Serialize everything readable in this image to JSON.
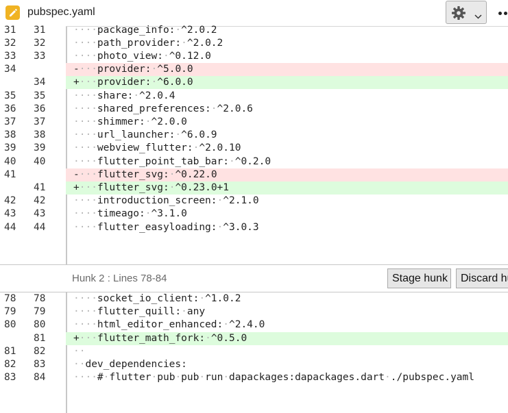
{
  "header": {
    "title": "pubspec.yaml",
    "file_icon": "edit-file-icon",
    "settings_icon": "gear-icon"
  },
  "hunk2": {
    "label": "Hunk 2 : Lines 78-84",
    "stage_label": "Stage hunk",
    "discard_label": "Discard hu"
  },
  "hunk1_rows": [
    {
      "old": "31",
      "new": "31",
      "type": "ctx",
      "indent": "    ",
      "text": "package_info: ^2.0.2"
    },
    {
      "old": "32",
      "new": "32",
      "type": "ctx",
      "indent": "    ",
      "text": "path_provider: ^2.0.2"
    },
    {
      "old": "33",
      "new": "33",
      "type": "ctx",
      "indent": "    ",
      "text": "photo_view: ^0.12.0"
    },
    {
      "old": "34",
      "new": "",
      "type": "del",
      "indent": "    ",
      "text": "provider: ^5.0.0"
    },
    {
      "old": "",
      "new": "34",
      "type": "add",
      "indent": "    ",
      "text": "provider: ^6.0.0"
    },
    {
      "old": "35",
      "new": "35",
      "type": "ctx",
      "indent": "    ",
      "text": "share: ^2.0.4"
    },
    {
      "old": "36",
      "new": "36",
      "type": "ctx",
      "indent": "    ",
      "text": "shared_preferences: ^2.0.6"
    },
    {
      "old": "37",
      "new": "37",
      "type": "ctx",
      "indent": "    ",
      "text": "shimmer: ^2.0.0"
    },
    {
      "old": "38",
      "new": "38",
      "type": "ctx",
      "indent": "    ",
      "text": "url_launcher: ^6.0.9"
    },
    {
      "old": "39",
      "new": "39",
      "type": "ctx",
      "indent": "    ",
      "text": "webview_flutter: ^2.0.10"
    },
    {
      "old": "40",
      "new": "40",
      "type": "ctx",
      "indent": "    ",
      "text": "flutter_point_tab_bar: ^0.2.0"
    },
    {
      "old": "41",
      "new": "",
      "type": "del",
      "indent": "    ",
      "text": "flutter_svg: ^0.22.0"
    },
    {
      "old": "",
      "new": "41",
      "type": "add",
      "indent": "    ",
      "text": "flutter_svg: ^0.23.0+1"
    },
    {
      "old": "42",
      "new": "42",
      "type": "ctx",
      "indent": "    ",
      "text": "introduction_screen: ^2.1.0"
    },
    {
      "old": "43",
      "new": "43",
      "type": "ctx",
      "indent": "    ",
      "text": "timeago: ^3.1.0"
    },
    {
      "old": "44",
      "new": "44",
      "type": "ctx",
      "indent": "    ",
      "text": "flutter_easyloading: ^3.0.3"
    }
  ],
  "hunk2_rows": [
    {
      "old": "78",
      "new": "78",
      "type": "ctx",
      "indent": "    ",
      "text": "socket_io_client: ^1.0.2"
    },
    {
      "old": "79",
      "new": "79",
      "type": "ctx",
      "indent": "    ",
      "text": "flutter_quill: any"
    },
    {
      "old": "80",
      "new": "80",
      "type": "ctx",
      "indent": "    ",
      "text": "html_editor_enhanced: ^2.4.0"
    },
    {
      "old": "",
      "new": "81",
      "type": "add",
      "indent": "    ",
      "text": "flutter_math_fork: ^0.5.0"
    },
    {
      "old": "81",
      "new": "82",
      "type": "ctx",
      "indent": "  ",
      "text": ""
    },
    {
      "old": "82",
      "new": "83",
      "type": "ctx",
      "indent": "  ",
      "text": "dev_dependencies:"
    },
    {
      "old": "83",
      "new": "84",
      "type": "ctx",
      "indent": "    ",
      "text": "# flutter pub pub run dapackages:dapackages.dart ./pubspec.yaml"
    }
  ]
}
